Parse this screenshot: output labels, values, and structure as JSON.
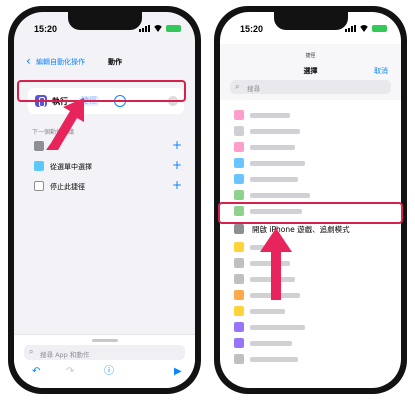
{
  "left_phone": {
    "status_time": "15:20",
    "battery": "",
    "nav": {
      "back_label": "編輯自動化操作",
      "title": "動作"
    },
    "action": {
      "label": "執行",
      "param": "捷徑"
    },
    "next_header": "下一個動作建議",
    "next_items": [
      {
        "label": ""
      },
      {
        "label": "從選單中選擇"
      },
      {
        "label": "停止此捷徑"
      }
    ],
    "search_placeholder": "搜尋 App 和動作"
  },
  "right_phone": {
    "status_time": "15:20",
    "nav": {
      "top_label": "捷徑",
      "title": "選擇",
      "cancel": "取消"
    },
    "search_placeholder": "搜尋",
    "highlighted_item": "開啟 iPhone 遊戲、追劇模式"
  },
  "colors": {
    "accent": "#0a84ff",
    "callout": "#d6214e"
  }
}
